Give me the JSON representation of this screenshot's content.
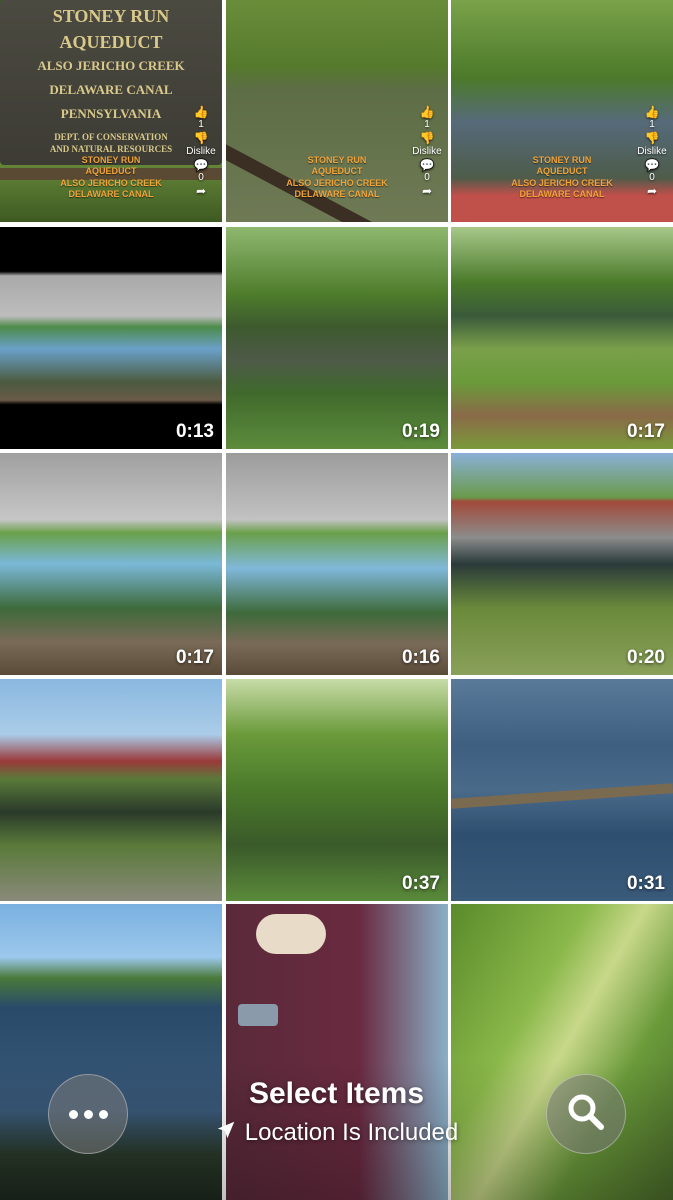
{
  "grid": {
    "items": [
      {
        "name": "photo-1-sign",
        "duration": ""
      },
      {
        "name": "photo-2-river-branch",
        "duration": ""
      },
      {
        "name": "photo-3-canal",
        "duration": ""
      },
      {
        "name": "video-1-underpass",
        "duration": "0:13"
      },
      {
        "name": "video-2-trees-water",
        "duration": "0:19"
      },
      {
        "name": "video-3-canal-path",
        "duration": "0:17"
      },
      {
        "name": "video-4-underpass",
        "duration": "0:17"
      },
      {
        "name": "video-5-underpass",
        "duration": "0:16"
      },
      {
        "name": "video-6-bridge",
        "duration": "0:20"
      },
      {
        "name": "photo-4-bridge-walker",
        "duration": ""
      },
      {
        "name": "video-7-forest",
        "duration": "0:37"
      },
      {
        "name": "video-8-river-log",
        "duration": "0:31"
      },
      {
        "name": "photo-5-river",
        "duration": ""
      },
      {
        "name": "photo-6-person",
        "duration": ""
      },
      {
        "name": "photo-7-blur",
        "duration": ""
      }
    ]
  },
  "sign": {
    "lines": [
      "STONEY RUN",
      "AQUEDUCT",
      "ALSO JERICHO CREEK",
      "DELAWARE CANAL",
      "PENNSYLVANIA",
      "DEPT. OF CONSERVATION",
      "AND NATURAL RESOURCES"
    ]
  },
  "reel_overlay": {
    "like_count": "1",
    "dislike_label": "Dislike",
    "comment_count": "0",
    "text_lines": [
      "STONEY RUN",
      "AQUEDUCT",
      "ALSO JERICHO CREEK",
      "DELAWARE CANAL"
    ]
  },
  "toolbar": {
    "title": "Select Items",
    "subtitle": "Location Is Included",
    "more_icon": "ellipsis-icon",
    "search_icon": "search-icon",
    "location_icon": "location-arrow-icon"
  }
}
